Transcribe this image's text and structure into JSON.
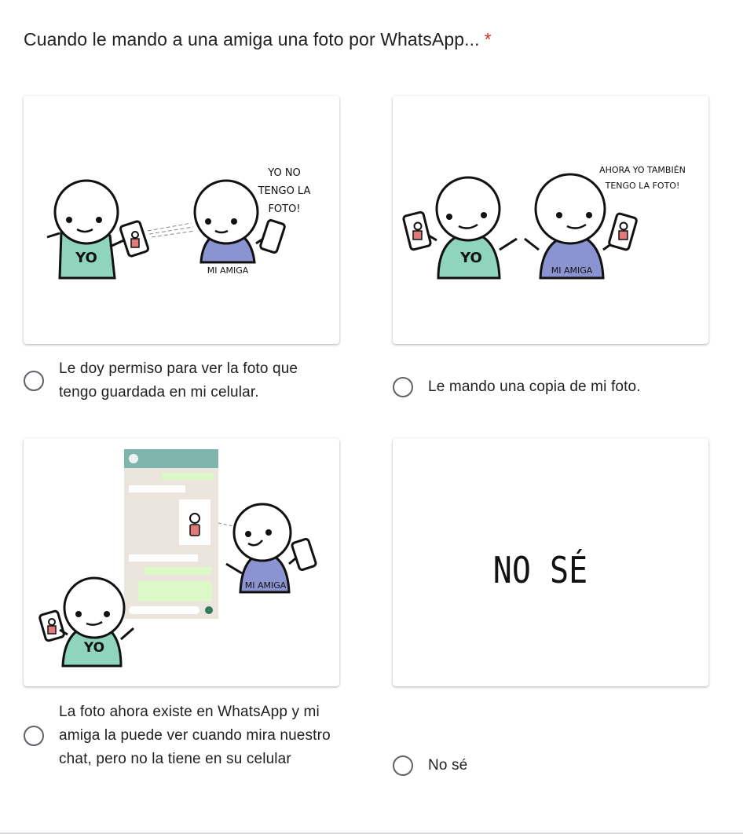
{
  "question": {
    "text": "Cuando le mando a una amiga una foto por WhatsApp...",
    "required_marker": "*"
  },
  "options": [
    {
      "label": "Le doy permiso para ver la foto que tengo guardada en mi celular.",
      "image": {
        "speech": [
          "YO NO",
          "TENGO LA",
          "FOTO!"
        ],
        "shirt_me": "YO",
        "shirt_friend": "MI AMIGA"
      }
    },
    {
      "label": "Le mando una copia de mi foto.",
      "image": {
        "speech": [
          "AHORA YO TAMBIÉN",
          "TENGO LA FOTO!"
        ],
        "shirt_me": "YO",
        "shirt_friend": "MI AMIGA"
      }
    },
    {
      "label": "La foto ahora existe en WhatsApp y mi amiga la puede ver cuando mira nuestro chat, pero no la tiene en su celular",
      "image": {
        "shirt_me": "YO",
        "shirt_friend": "MI AMIGA"
      }
    },
    {
      "label": "No sé",
      "image": {
        "text": "NO SÉ"
      }
    }
  ],
  "colors": {
    "shirt_green": "#8fd4bd",
    "shirt_blue": "#8b94d0",
    "chat_bg": "#ece5dd",
    "chat_header": "#7fb5ad",
    "bubble_green": "#dcf8c6",
    "photo_red": "#e07a7a"
  }
}
